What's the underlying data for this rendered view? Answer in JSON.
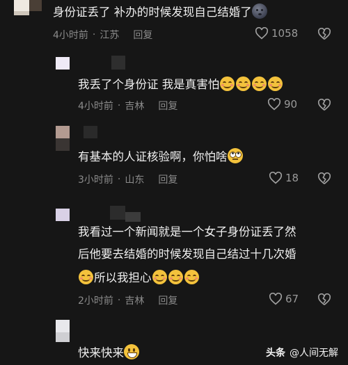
{
  "comments": [
    {
      "text": "身份证丢了 补办的时候发现自己结婚了",
      "time": "4小时前",
      "location": "江苏",
      "reply_label": "回复",
      "likes": "1058"
    },
    {
      "text": "我丢了个身份证 我是真害怕",
      "time": "4小时前",
      "location": "吉林",
      "reply_label": "回复",
      "likes": "90"
    },
    {
      "text": "有基本的人证核验啊，你怕啥",
      "time": "3小时前",
      "location": "山东",
      "reply_label": "回复",
      "likes": "18"
    },
    {
      "text_line1": "我看过一个新闻就是一个女子身份证丢了然",
      "text_line2": "后他要去结婚的时候发现自己结过十几次婚",
      "text_line3": "所以我担心",
      "time": "2小时前",
      "location": "吉林",
      "reply_label": "回复",
      "likes": "67"
    },
    {
      "text": "快来快来"
    }
  ],
  "separator": "·",
  "watermark": {
    "logo": "头条",
    "handle": "@人间无解"
  },
  "icons": {
    "like": "heart-outline-icon",
    "dislike": "broken-heart-icon"
  }
}
